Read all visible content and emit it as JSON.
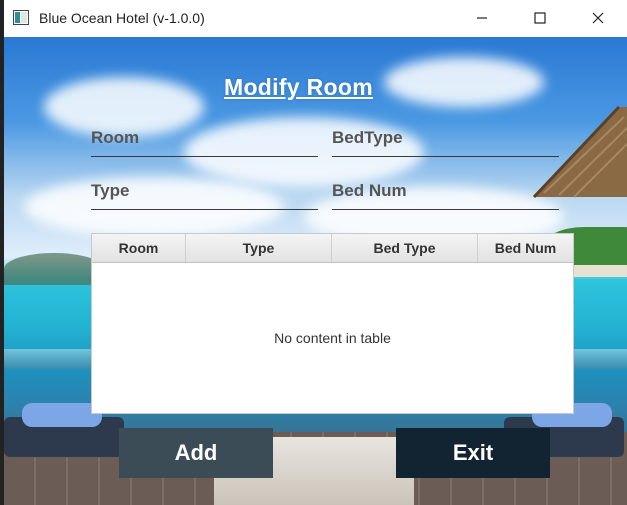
{
  "window": {
    "title": "Blue Ocean Hotel (v-1.0.0)"
  },
  "form": {
    "title": "Modify Room",
    "fields": {
      "room": "Room",
      "bed_type": "BedType",
      "type": "Type",
      "bed_num": "Bed Num"
    }
  },
  "table": {
    "columns": [
      "Room",
      "Type",
      "Bed Type",
      "Bed Num"
    ],
    "rows": [],
    "empty_message": "No content in table"
  },
  "buttons": {
    "add": "Add",
    "exit": "Exit"
  },
  "colors": {
    "add_button": "#3b4c56",
    "exit_button": "#122331"
  },
  "icons": [
    "app-icon",
    "minimize-icon",
    "maximize-icon",
    "close-icon"
  ]
}
